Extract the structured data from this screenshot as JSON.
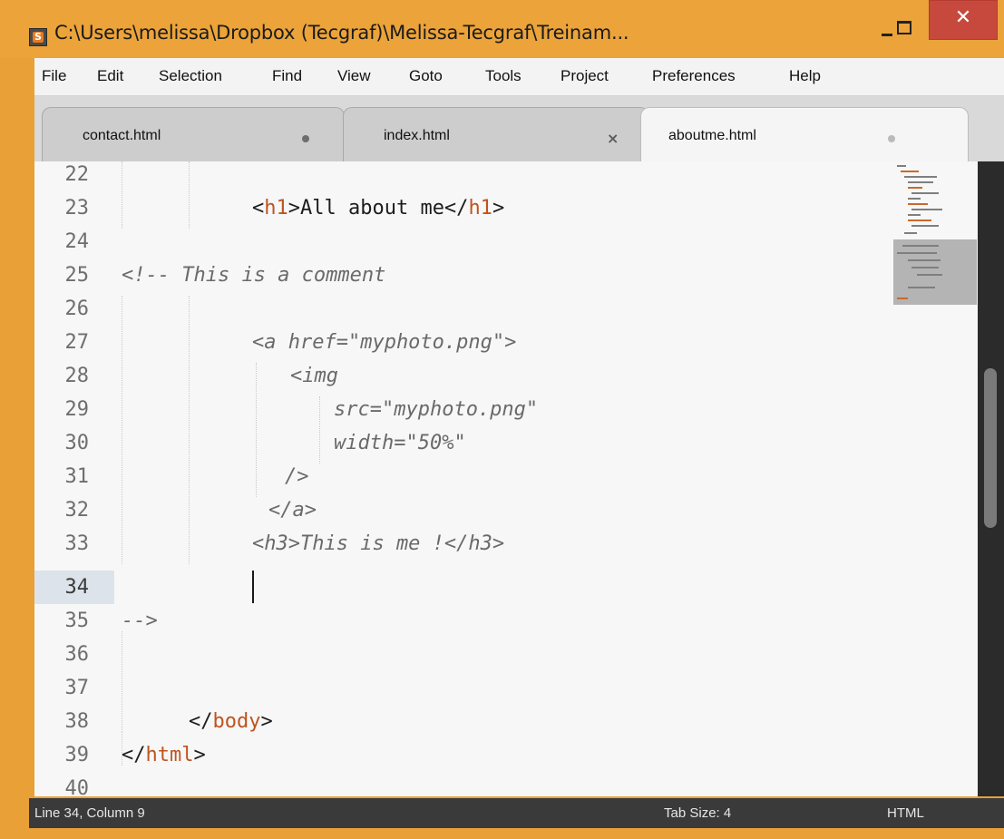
{
  "window": {
    "title": "C:\\Users\\melissa\\Dropbox (Tecgraf)\\Melissa-Tecgraf\\Treinam...",
    "minimize_glyph": "–",
    "close_glyph": "✕"
  },
  "menu": [
    {
      "label": "File"
    },
    {
      "label": "Edit"
    },
    {
      "label": "Selection"
    },
    {
      "label": "Find"
    },
    {
      "label": "View"
    },
    {
      "label": "Goto"
    },
    {
      "label": "Tools"
    },
    {
      "label": "Project"
    },
    {
      "label": "Preferences"
    },
    {
      "label": "Help"
    }
  ],
  "tabs": [
    {
      "label": "contact.html",
      "indicator": "dirty-dot",
      "active": false
    },
    {
      "label": "index.html",
      "indicator": "close-x",
      "active": false
    },
    {
      "label": "aboutme.html",
      "indicator": "dirty-dot",
      "active": true
    }
  ],
  "tab_close_glyph": "×",
  "editor": {
    "lines": [
      {
        "n": "22"
      },
      {
        "n": "23"
      },
      {
        "n": "24"
      },
      {
        "n": "25"
      },
      {
        "n": "26"
      },
      {
        "n": "27"
      },
      {
        "n": "28"
      },
      {
        "n": "29"
      },
      {
        "n": "30"
      },
      {
        "n": "31"
      },
      {
        "n": "32"
      },
      {
        "n": "33"
      },
      {
        "n": "34"
      },
      {
        "n": "35"
      },
      {
        "n": "36"
      },
      {
        "n": "37"
      },
      {
        "n": "38"
      },
      {
        "n": "39"
      },
      {
        "n": "40"
      }
    ],
    "code": {
      "l23_open": "<",
      "l23_tag": "h1",
      "l23_text": ">All about me</",
      "l23_tag2": "h1",
      "l23_close": ">",
      "l25": "<!-- This is a comment",
      "l27": "<a href=\"myphoto.png\">",
      "l28": "<img",
      "l29": "src=\"myphoto.png\"",
      "l30": "width=\"50%\"",
      "l31": "/>",
      "l32": "</a>",
      "l33": "<h3>This is me !</h3>",
      "l35": "-->",
      "l38_open": "</",
      "l38_tag": "body",
      "l38_close": ">",
      "l39_open": "</",
      "l39_tag": "html",
      "l39_close": ">"
    },
    "current_line": "34"
  },
  "status": {
    "position": "Line 34, Column 9",
    "tab_size": "Tab Size: 4",
    "syntax": "HTML"
  },
  "colors": {
    "window_frame": "#eba33a",
    "close_button": "#c7483c",
    "tag_name": "#c0541e",
    "comment": "#6a6a6a",
    "editor_bg": "#f7f7f7",
    "status_bg": "#3a3a3a"
  }
}
